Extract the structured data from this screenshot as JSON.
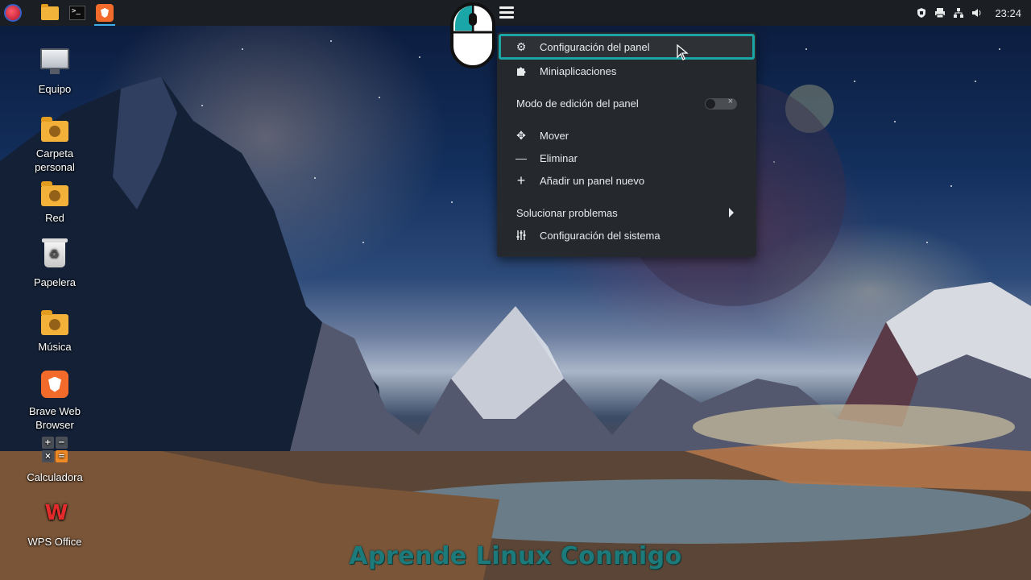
{
  "panel": {
    "taskbar_items": [
      {
        "name": "app-launcher",
        "icon": "app-menu-icon"
      },
      {
        "name": "file-manager",
        "icon": "folder-icon"
      },
      {
        "name": "terminal",
        "icon": "terminal-icon"
      },
      {
        "name": "brave-browser",
        "icon": "brave-icon",
        "active": true
      }
    ],
    "tray_icons": [
      "shield-update-icon",
      "printer-icon",
      "network-icon",
      "volume-icon"
    ],
    "clock": "23:24",
    "accent_color": "#3daee9"
  },
  "desktop_icons": [
    {
      "label": "Equipo",
      "icon": "computer-icon"
    },
    {
      "label": "Carpeta personal",
      "icon": "home-folder-icon"
    },
    {
      "label": "Red",
      "icon": "network-folder-icon"
    },
    {
      "label": "Papelera",
      "icon": "trash-icon"
    },
    {
      "label": "Música",
      "icon": "music-folder-icon"
    },
    {
      "label": "Brave Web Browser",
      "icon": "brave-icon"
    },
    {
      "label": "Calculadora",
      "icon": "calculator-icon"
    },
    {
      "label": "WPS Office",
      "icon": "wps-office-icon"
    }
  ],
  "context_menu": {
    "items": [
      {
        "label": "Configuración del panel",
        "icon": "gear-icon",
        "highlighted": true
      },
      {
        "label": "Miniaplicaciones",
        "icon": "puzzle-icon"
      },
      {
        "label": "Modo de edición del panel",
        "toggle": false
      },
      {
        "label": "Mover",
        "icon": "move-icon"
      },
      {
        "label": "Eliminar",
        "icon": "minus-icon"
      },
      {
        "label": "Añadir un panel nuevo",
        "icon": "plus-icon"
      },
      {
        "label": "Solucionar problemas",
        "submenu": true
      },
      {
        "label": "Configuración del sistema",
        "icon": "sliders-icon"
      }
    ],
    "highlight_color": "#1aa6a6"
  },
  "watermark": "Aprende Linux Conmigo"
}
